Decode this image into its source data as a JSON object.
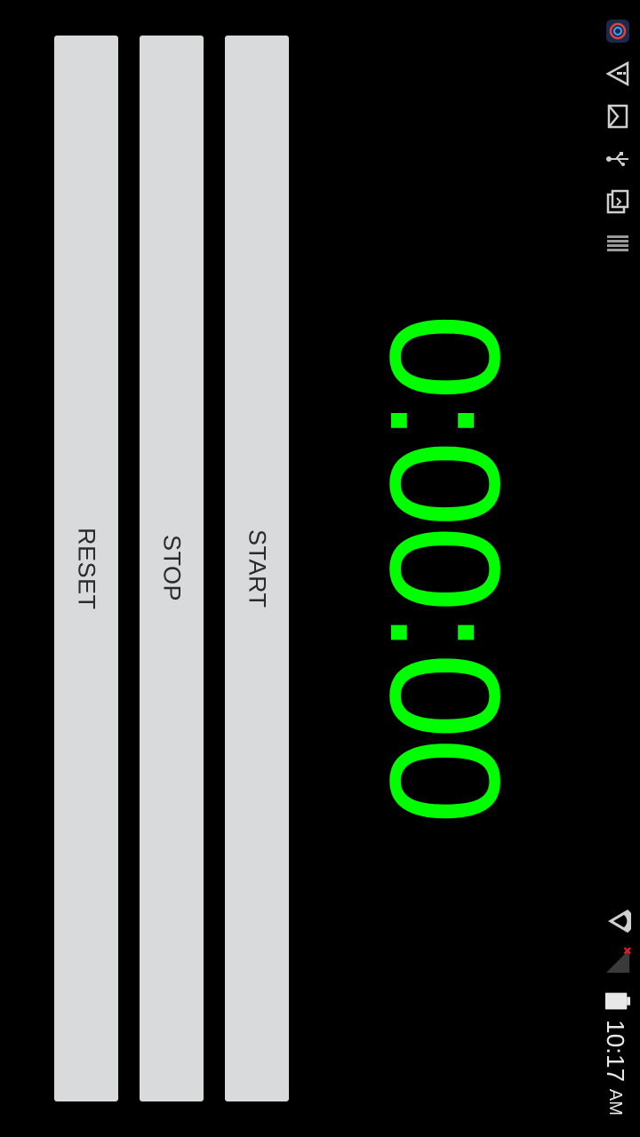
{
  "timer": {
    "display": "0:00:00"
  },
  "buttons": {
    "start": "START",
    "stop": "STOP",
    "reset": "RESET"
  },
  "status_bar": {
    "time": "10:17",
    "ampm": "AM",
    "icons": [
      "app-notification-icon",
      "warning-icon",
      "gmail-icon",
      "usb-icon",
      "clipboard-icon",
      "storage-icon",
      "wifi-icon",
      "signal-icon",
      "battery-icon"
    ]
  },
  "colors": {
    "timer_green": "#00ff00",
    "button_bg": "#d9dadb",
    "background": "#000000"
  }
}
